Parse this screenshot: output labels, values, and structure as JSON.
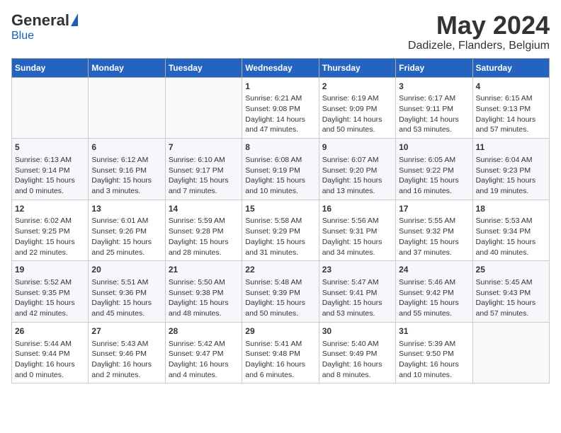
{
  "header": {
    "logo_general": "General",
    "logo_blue": "Blue",
    "month": "May 2024",
    "location": "Dadizele, Flanders, Belgium"
  },
  "weekdays": [
    "Sunday",
    "Monday",
    "Tuesday",
    "Wednesday",
    "Thursday",
    "Friday",
    "Saturday"
  ],
  "weeks": [
    [
      null,
      null,
      null,
      {
        "day": 1,
        "sunrise": "6:21 AM",
        "sunset": "9:08 PM",
        "daylight": "14 hours and 47 minutes."
      },
      {
        "day": 2,
        "sunrise": "6:19 AM",
        "sunset": "9:09 PM",
        "daylight": "14 hours and 50 minutes."
      },
      {
        "day": 3,
        "sunrise": "6:17 AM",
        "sunset": "9:11 PM",
        "daylight": "14 hours and 53 minutes."
      },
      {
        "day": 4,
        "sunrise": "6:15 AM",
        "sunset": "9:13 PM",
        "daylight": "14 hours and 57 minutes."
      }
    ],
    [
      {
        "day": 5,
        "sunrise": "6:13 AM",
        "sunset": "9:14 PM",
        "daylight": "15 hours and 0 minutes."
      },
      {
        "day": 6,
        "sunrise": "6:12 AM",
        "sunset": "9:16 PM",
        "daylight": "15 hours and 3 minutes."
      },
      {
        "day": 7,
        "sunrise": "6:10 AM",
        "sunset": "9:17 PM",
        "daylight": "15 hours and 7 minutes."
      },
      {
        "day": 8,
        "sunrise": "6:08 AM",
        "sunset": "9:19 PM",
        "daylight": "15 hours and 10 minutes."
      },
      {
        "day": 9,
        "sunrise": "6:07 AM",
        "sunset": "9:20 PM",
        "daylight": "15 hours and 13 minutes."
      },
      {
        "day": 10,
        "sunrise": "6:05 AM",
        "sunset": "9:22 PM",
        "daylight": "15 hours and 16 minutes."
      },
      {
        "day": 11,
        "sunrise": "6:04 AM",
        "sunset": "9:23 PM",
        "daylight": "15 hours and 19 minutes."
      }
    ],
    [
      {
        "day": 12,
        "sunrise": "6:02 AM",
        "sunset": "9:25 PM",
        "daylight": "15 hours and 22 minutes."
      },
      {
        "day": 13,
        "sunrise": "6:01 AM",
        "sunset": "9:26 PM",
        "daylight": "15 hours and 25 minutes."
      },
      {
        "day": 14,
        "sunrise": "5:59 AM",
        "sunset": "9:28 PM",
        "daylight": "15 hours and 28 minutes."
      },
      {
        "day": 15,
        "sunrise": "5:58 AM",
        "sunset": "9:29 PM",
        "daylight": "15 hours and 31 minutes."
      },
      {
        "day": 16,
        "sunrise": "5:56 AM",
        "sunset": "9:31 PM",
        "daylight": "15 hours and 34 minutes."
      },
      {
        "day": 17,
        "sunrise": "5:55 AM",
        "sunset": "9:32 PM",
        "daylight": "15 hours and 37 minutes."
      },
      {
        "day": 18,
        "sunrise": "5:53 AM",
        "sunset": "9:34 PM",
        "daylight": "15 hours and 40 minutes."
      }
    ],
    [
      {
        "day": 19,
        "sunrise": "5:52 AM",
        "sunset": "9:35 PM",
        "daylight": "15 hours and 42 minutes."
      },
      {
        "day": 20,
        "sunrise": "5:51 AM",
        "sunset": "9:36 PM",
        "daylight": "15 hours and 45 minutes."
      },
      {
        "day": 21,
        "sunrise": "5:50 AM",
        "sunset": "9:38 PM",
        "daylight": "15 hours and 48 minutes."
      },
      {
        "day": 22,
        "sunrise": "5:48 AM",
        "sunset": "9:39 PM",
        "daylight": "15 hours and 50 minutes."
      },
      {
        "day": 23,
        "sunrise": "5:47 AM",
        "sunset": "9:41 PM",
        "daylight": "15 hours and 53 minutes."
      },
      {
        "day": 24,
        "sunrise": "5:46 AM",
        "sunset": "9:42 PM",
        "daylight": "15 hours and 55 minutes."
      },
      {
        "day": 25,
        "sunrise": "5:45 AM",
        "sunset": "9:43 PM",
        "daylight": "15 hours and 57 minutes."
      }
    ],
    [
      {
        "day": 26,
        "sunrise": "5:44 AM",
        "sunset": "9:44 PM",
        "daylight": "16 hours and 0 minutes."
      },
      {
        "day": 27,
        "sunrise": "5:43 AM",
        "sunset": "9:46 PM",
        "daylight": "16 hours and 2 minutes."
      },
      {
        "day": 28,
        "sunrise": "5:42 AM",
        "sunset": "9:47 PM",
        "daylight": "16 hours and 4 minutes."
      },
      {
        "day": 29,
        "sunrise": "5:41 AM",
        "sunset": "9:48 PM",
        "daylight": "16 hours and 6 minutes."
      },
      {
        "day": 30,
        "sunrise": "5:40 AM",
        "sunset": "9:49 PM",
        "daylight": "16 hours and 8 minutes."
      },
      {
        "day": 31,
        "sunrise": "5:39 AM",
        "sunset": "9:50 PM",
        "daylight": "16 hours and 10 minutes."
      },
      null
    ]
  ]
}
